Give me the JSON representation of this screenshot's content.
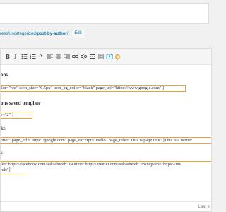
{
  "permalink": {
    "prefix": "ress/uncategorized/",
    "slug": "post-by-author",
    "suffix": "/",
    "edit_label": "Edit"
  },
  "toolbar": {
    "icons": [
      "bold-icon",
      "italic-icon",
      "bulleted-list-icon",
      "numbered-list-icon",
      "blockquote-icon",
      "align-left-icon",
      "align-center-icon",
      "align-right-icon",
      "link-icon",
      "unlink-icon",
      "read-more-icon",
      "toolbar-toggle-icon",
      "shortcode-icon",
      "settings-icon"
    ]
  },
  "content": {
    "heading_1": "ons",
    "shortcode_1": "color=\"red\" icon_size=\"6.5px\" icon_bg_color=\"black\" page_url=\"https://www.google.com\" ]",
    "heading_2": "ons saved template",
    "shortcode_2": "ate=\"2\" ]",
    "heading_3": "ks",
    "shortcode_3": "twitter\" page_url=\"https://google.com\" page_excerpt=\"Hello\" page_title=\"This is page title\" ]This is a twitter",
    "heading_4": "s",
    "shortcode_4_line1": "ook=\"https://facebook.com/aakashweb\" twitter=\"https://twitter.com/aakashweb\" instagram=\"https://ins",
    "shortcode_4_line2": "circle\"]"
  },
  "status": {
    "text": "Last e"
  }
}
